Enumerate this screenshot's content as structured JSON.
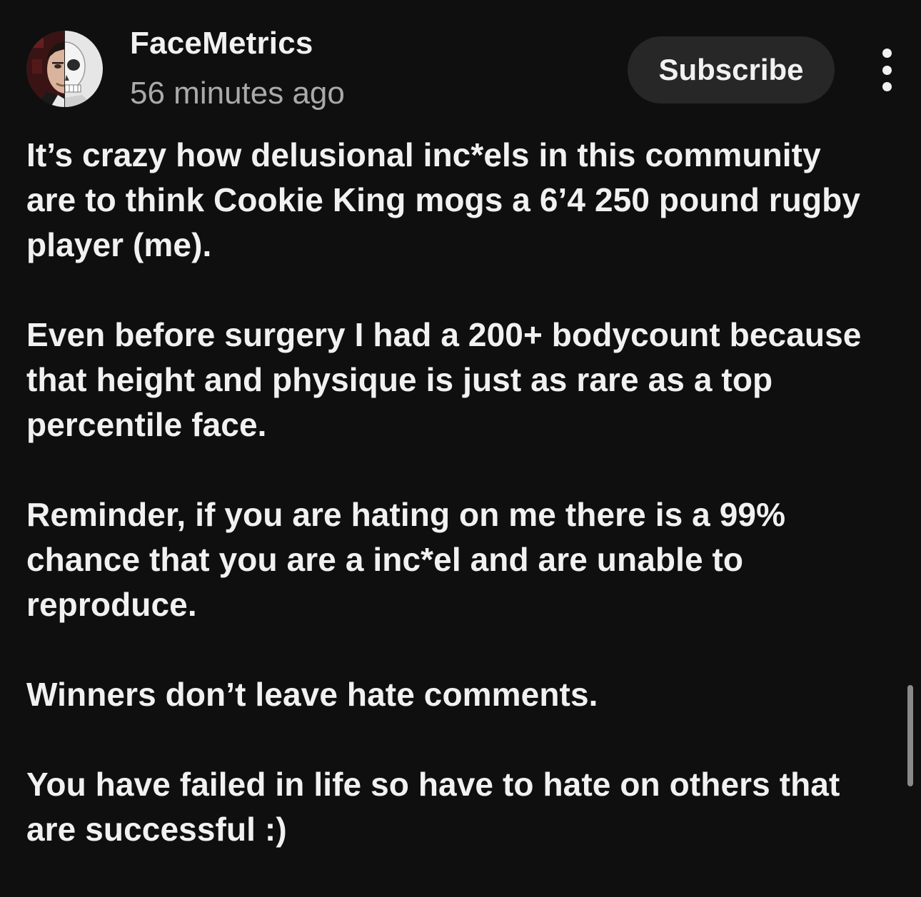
{
  "post": {
    "channel_name": "FaceMetrics",
    "timestamp": "56 minutes ago",
    "subscribe_label": "Subscribe",
    "avatar_icon": "face-skull-split-avatar",
    "more_icon": "vertical-ellipsis-icon",
    "paragraphs": [
      "It’s crazy how delusional inc*els in this community are to think Cookie King mogs a 6’4 250 pound rugby player (me).",
      "Even before surgery I had a 200+ bodycount because that height and physique is just as rare as a top percentile face.",
      "Reminder, if you are hating on me there is a 99% chance that you are a inc*el and are unable to reproduce.",
      "Winners don’t leave hate comments.",
      "You have failed in life so have to hate on others that are successful :)"
    ]
  },
  "colors": {
    "background": "#0f0f0f",
    "text_primary": "#f1f1f1",
    "text_secondary": "#aaaaaa",
    "button_background": "#272727"
  }
}
